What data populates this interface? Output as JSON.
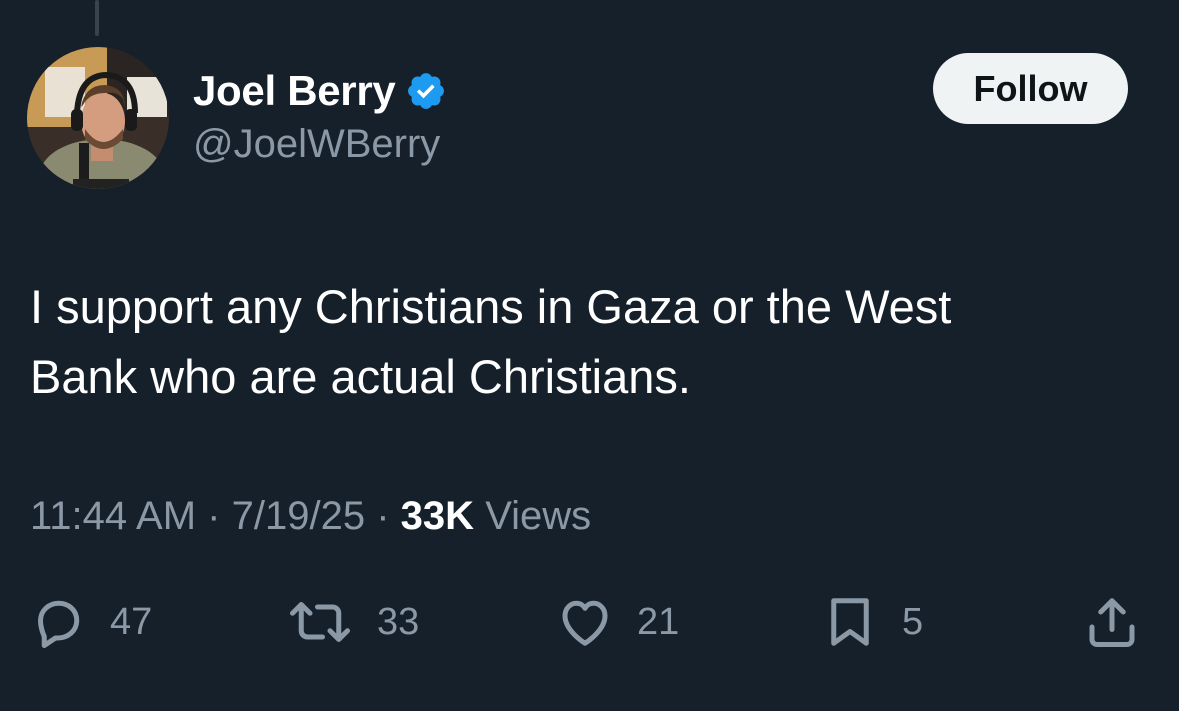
{
  "author": {
    "display_name": "Joel Berry",
    "handle": "@JoelWBerry",
    "verified": true
  },
  "follow_button": {
    "label": "Follow"
  },
  "tweet": {
    "text_line_1": "I support any Christians in Gaza or the West",
    "text_line_2": "Bank who are actual Christians.",
    "time": "11:44 AM",
    "separator": "·",
    "date": "7/19/25",
    "views_count": "33K",
    "views_label": "Views"
  },
  "actions": {
    "replies": "47",
    "reposts": "33",
    "likes": "21",
    "bookmarks": "5"
  },
  "icons": {
    "reply": "reply-icon",
    "repost": "repost-icon",
    "like": "heart-icon",
    "bookmark": "bookmark-icon",
    "share": "share-icon",
    "verified": "verified-badge-icon"
  },
  "colors": {
    "background": "#15202b",
    "primary_text": "#ffffff",
    "secondary_text": "#8b98a5",
    "verified_blue": "#1d9bf0",
    "follow_button_bg": "#eff3f4"
  }
}
